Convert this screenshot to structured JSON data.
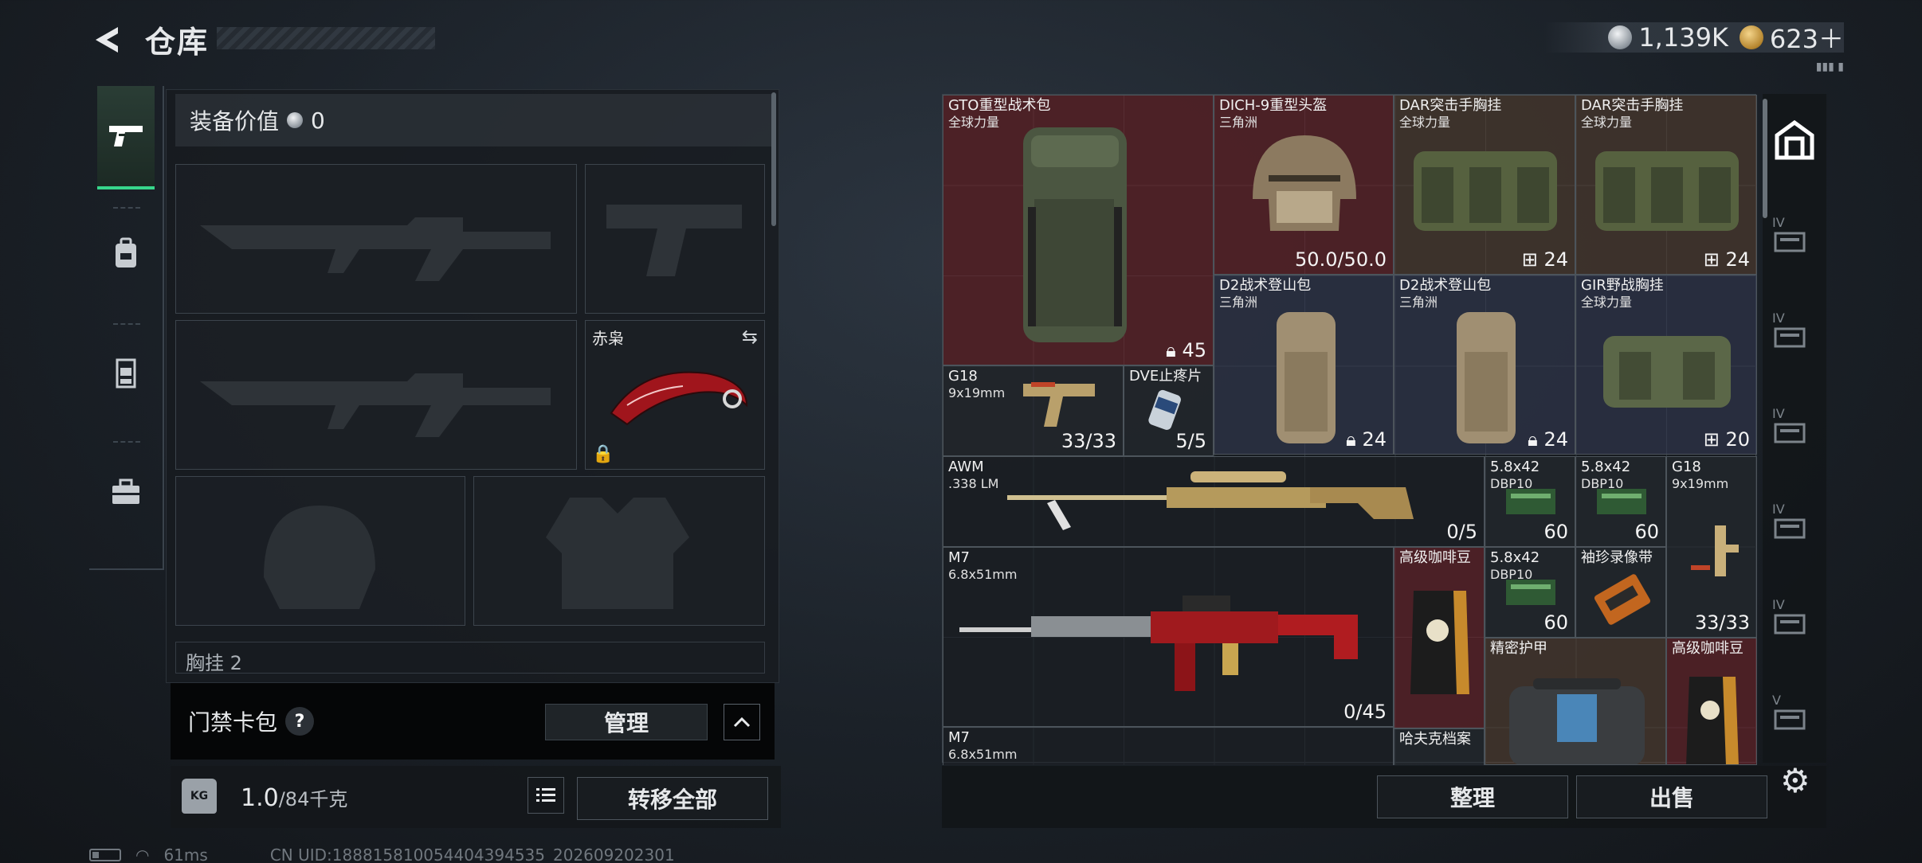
{
  "header": {
    "title": "仓库",
    "currency": [
      {
        "icon": "silver-coin-icon",
        "value": "1,139K"
      },
      {
        "icon": "gold-coin-icon",
        "value": "623＋"
      }
    ],
    "note": "▮▮▮ ▮"
  },
  "left_rail": {
    "tabs": [
      {
        "icon": "pistol-icon",
        "active": true
      },
      {
        "icon": "backpack-icon",
        "active": false
      },
      {
        "icon": "vest-icon",
        "active": false
      },
      {
        "icon": "briefcase-icon",
        "active": false
      }
    ]
  },
  "loadout": {
    "equip_value_label": "装备价值",
    "equip_value": "0",
    "knife_label": "赤枭",
    "chest_label": "胸挂 2",
    "keypack_label": "门禁卡包",
    "keypack_help": "?",
    "manage_label": "管理",
    "weight_value": "1.0",
    "weight_max": "/84千克",
    "kg_label": "KG",
    "transfer_label": "转移全部"
  },
  "status": {
    "ping": "61ms",
    "uid": "CN UID:188815810054404394535_202609202301"
  },
  "inventory": {
    "items": [
      {
        "name": "GTO重型战术包",
        "sub": "全球力量",
        "count": "45",
        "count_icon": "capacity-icon",
        "color": "red"
      },
      {
        "name": "DICH-9重型头盔",
        "sub": "三角洲",
        "count": "50.0/50.0",
        "color": "red"
      },
      {
        "name": "DAR突击手胸挂",
        "sub": "全球力量",
        "count": "24",
        "count_icon": "slots-icon",
        "color": "brown"
      },
      {
        "name": "DAR突击手胸挂",
        "sub": "全球力量",
        "count": "24",
        "count_icon": "slots-icon",
        "color": "brown"
      },
      {
        "name": "D2战术登山包",
        "sub": "三角洲",
        "count": "24",
        "count_icon": "capacity-icon",
        "color": "blue"
      },
      {
        "name": "D2战术登山包",
        "sub": "三角洲",
        "count": "24",
        "count_icon": "capacity-icon",
        "color": "blue"
      },
      {
        "name": "GIR野战胸挂",
        "sub": "全球力量",
        "count": "20",
        "count_icon": "slots-icon",
        "color": "blue"
      },
      {
        "name": "G18",
        "sub": "9x19mm",
        "count": "33/33",
        "color": "gray"
      },
      {
        "name": "DVE止疼片",
        "sub": "",
        "count": "5/5",
        "color": "gray"
      },
      {
        "name": "AWM",
        "sub": ".338 LM",
        "count": "0/5",
        "color": "wpn"
      },
      {
        "name": "5.8x42",
        "sub": "DBP10",
        "count": "60",
        "color": "gray"
      },
      {
        "name": "5.8x42",
        "sub": "DBP10",
        "count": "60",
        "color": "gray"
      },
      {
        "name": "G18",
        "sub": "9x19mm",
        "count": "33/33",
        "color": "gray"
      },
      {
        "name": "M7",
        "sub": "6.8x51mm",
        "count": "0/45",
        "color": "wpn"
      },
      {
        "name": "高级咖啡豆",
        "sub": "",
        "count": "",
        "color": "red"
      },
      {
        "name": "5.8x42",
        "sub": "DBP10",
        "count": "60",
        "color": "gray"
      },
      {
        "name": "袖珍录像带",
        "sub": "",
        "count": "",
        "color": "gray"
      },
      {
        "name": "精密护甲",
        "sub": "",
        "count": "",
        "color": "brown"
      },
      {
        "name": "高级咖啡豆",
        "sub": "",
        "count": "",
        "color": "red"
      },
      {
        "name": "M7",
        "sub": "6.8x51mm",
        "count": "",
        "color": "wpn"
      },
      {
        "name": "哈夫克档案",
        "sub": "",
        "count": "",
        "color": "gray"
      }
    ]
  },
  "right_rail": {
    "tabs": [
      {
        "icon": "vault-icon",
        "label": ""
      },
      {
        "icon": "storage-tier-icon",
        "label": "IV"
      },
      {
        "icon": "storage-tier-icon",
        "label": "IV"
      },
      {
        "icon": "storage-tier-icon",
        "label": "IV"
      },
      {
        "icon": "storage-tier-icon",
        "label": "IV"
      },
      {
        "icon": "storage-tier-icon",
        "label": "IV"
      },
      {
        "icon": "storage-tier-icon",
        "label": "V"
      }
    ]
  },
  "actions": {
    "sort_label": "整理",
    "sell_label": "出售"
  },
  "colors": {
    "accent": "#37d68c",
    "red_rarity": "#78262c",
    "brown_rarity": "#5c4634",
    "blue_rarity": "#383e58"
  }
}
